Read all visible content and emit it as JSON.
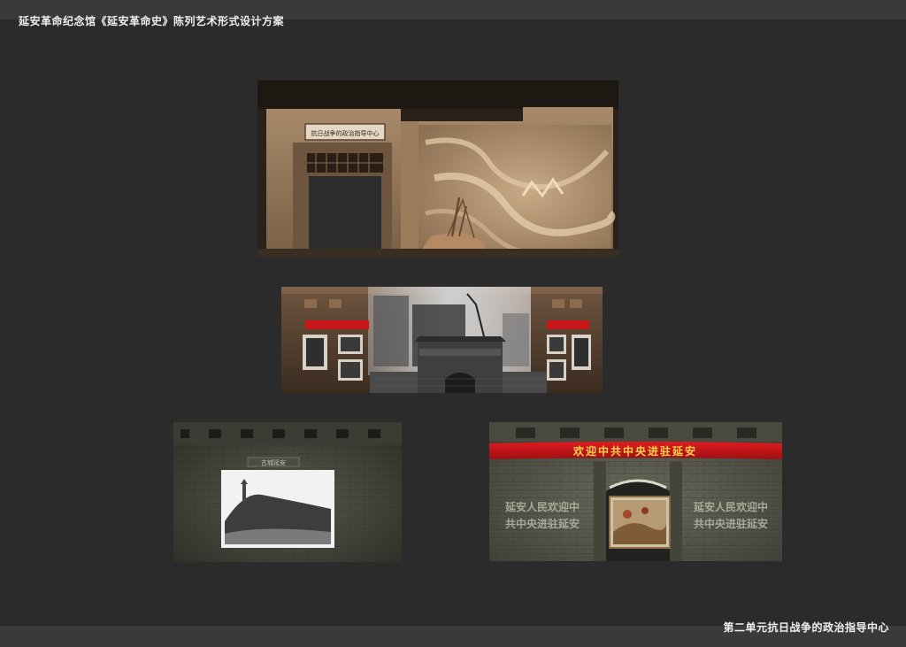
{
  "header": {
    "title": "延安革命纪念馆《延安革命史》陈列艺术形式设计方案"
  },
  "footer": {
    "caption": "第二单元抗日战争的政治指导中心"
  },
  "panels": {
    "top": {
      "sign": "抗日战争的政治指导中心"
    },
    "middle": {},
    "bottom_left": {
      "sign": "古城延安"
    },
    "bottom_right": {
      "banner": "欢迎中共中央进驻延安",
      "slogan_left_1": "延安人民欢迎中",
      "slogan_left_2": "共中央进驻延安",
      "slogan_right_1": "延安人民欢迎中",
      "slogan_right_2": "共中央进驻延安"
    }
  },
  "colors": {
    "background": "#2b2b2b",
    "banner_red": "#c8151a",
    "banner_text": "#ffd24a",
    "wall_stone": "#4b4a40",
    "sand_relief": "#b99873"
  }
}
